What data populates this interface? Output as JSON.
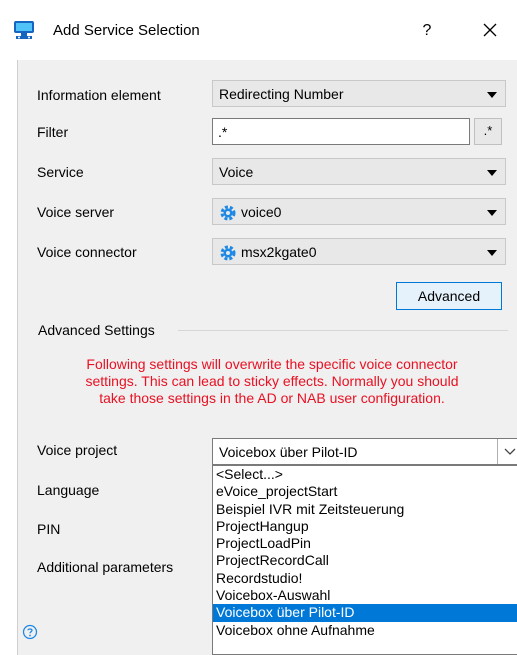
{
  "window": {
    "title": "Add Service Selection",
    "help_label": "?",
    "close_label": "✕"
  },
  "form": {
    "information_element": {
      "label": "Information element",
      "value": "Redirecting Number"
    },
    "filter": {
      "label": "Filter",
      "value": ".*",
      "regex_button": ".*"
    },
    "service": {
      "label": "Service",
      "value": "Voice"
    },
    "voice_server": {
      "label": "Voice server",
      "value": "voice0",
      "icon": "gear-icon"
    },
    "voice_connector": {
      "label": "Voice connector",
      "value": "msx2kgate0",
      "icon": "gear-icon"
    },
    "advanced_button": "Advanced"
  },
  "advanced_settings": {
    "title": "Advanced Settings",
    "warning_lines": [
      "Following settings will overwrite the specific voice connector",
      "settings. This can lead to sticky effects. Normally you should",
      "take those settings in the AD or NAB user configuration."
    ],
    "voice_project": {
      "label": "Voice project",
      "value": "Voicebox über Pilot-ID"
    },
    "language": {
      "label": "Language"
    },
    "pin": {
      "label": "PIN"
    },
    "additional_parameters": {
      "label": "Additional parameters"
    },
    "dropdown_options": [
      "<Select...>",
      "eVoice_projectStart",
      "Beispiel IVR mit Zeitsteuerung",
      "ProjectHangup",
      "ProjectLoadPin",
      "ProjectRecordCall",
      "Recordstudio!",
      "Voicebox-Auswahl",
      "Voicebox über Pilot-ID",
      "Voicebox ohne Aufnahme"
    ],
    "selected_index": 8
  },
  "colors": {
    "warning": "#e81123",
    "selection": "#0078d7",
    "panel_bg": "#f0f0f0"
  }
}
